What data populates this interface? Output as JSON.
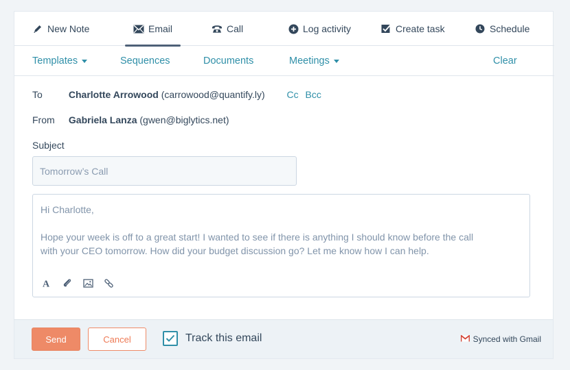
{
  "tabs": [
    {
      "label": "New Note",
      "icon": "pencil-icon"
    },
    {
      "label": "Email",
      "icon": "envelope-icon",
      "active": true
    },
    {
      "label": "Call",
      "icon": "phone-icon"
    },
    {
      "label": "Log activity",
      "icon": "plus-circle-icon"
    },
    {
      "label": "Create task",
      "icon": "checkbox-icon"
    },
    {
      "label": "Schedule",
      "icon": "clock-icon"
    }
  ],
  "subnav": {
    "templates": "Templates",
    "sequences": "Sequences",
    "documents": "Documents",
    "meetings": "Meetings",
    "clear": "Clear"
  },
  "email": {
    "to_label": "To",
    "to_name": "Charlotte Arrowood",
    "to_address": "(carrowood@quantify.ly)",
    "cc": "Cc",
    "bcc": "Bcc",
    "from_label": "From",
    "from_name": "Gabriela Lanza",
    "from_address": "(gwen@biglytics.net)",
    "subject_label": "Subject",
    "subject_value": "Tomorrow’s Call",
    "body_greeting": "Hi Charlotte,",
    "body_line1": "Hope your week is off to a great start! I wanted to see if there is anything I should know before the call",
    "body_line2": "with your CEO tomorrow. How did your budget discussion go? Let me know how I can help."
  },
  "toolbar": [
    "text-format-icon",
    "paperclip-icon",
    "image-icon",
    "link-icon"
  ],
  "footer": {
    "send": "Send",
    "cancel": "Cancel",
    "track": "Track this email",
    "track_checked": true,
    "synced": "Synced with Gmail"
  },
  "colors": {
    "accent_teal": "#2f8fa8",
    "send_orange": "#ee8a67",
    "text_dark": "#33475b",
    "gmail_red": "#d44638"
  }
}
